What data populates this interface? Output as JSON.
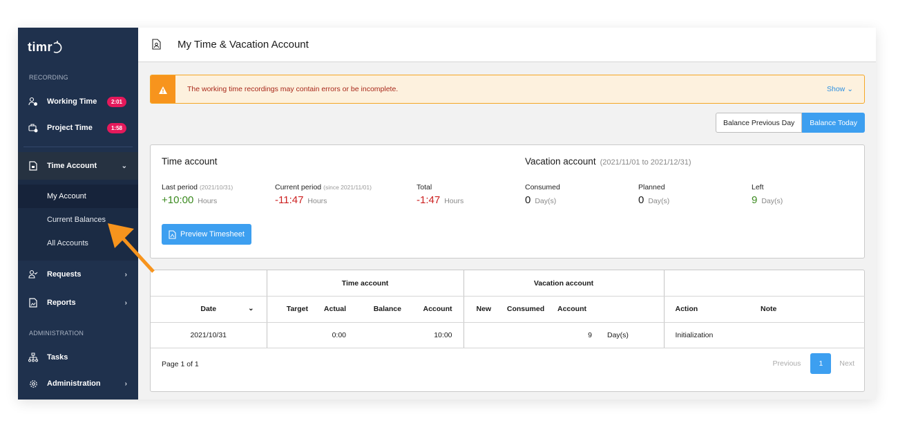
{
  "app": {
    "logo_text": "timr"
  },
  "sidebar": {
    "section_recording": "RECORDING",
    "section_administration": "ADMINISTRATION",
    "items": [
      {
        "label": "Working Time",
        "badge": "2:01",
        "icon": "user-clock-icon"
      },
      {
        "label": "Project Time",
        "badge": "1:58",
        "icon": "briefcase-clock-icon"
      },
      {
        "label": "Time Account",
        "icon": "document-icon",
        "expanded": true
      },
      {
        "label": "Requests",
        "icon": "user-check-icon"
      },
      {
        "label": "Reports",
        "icon": "report-icon"
      },
      {
        "label": "Tasks",
        "icon": "hierarchy-icon"
      },
      {
        "label": "Administration",
        "icon": "gear-icon"
      }
    ],
    "sub_items": [
      {
        "label": "My Account",
        "active": true
      },
      {
        "label": "Current Balances"
      },
      {
        "label": "All Accounts"
      }
    ]
  },
  "header": {
    "title": "My Time & Vacation Account"
  },
  "alert": {
    "message": "The working time recordings may contain errors or be incomplete.",
    "show_label": "Show"
  },
  "balance_toggle": {
    "previous_day": "Balance Previous Day",
    "today": "Balance Today",
    "selected": "today"
  },
  "time_account": {
    "title": "Time account",
    "last_period": {
      "label": "Last period",
      "hint": "(2021/10/31)",
      "value": "+10:00",
      "unit": "Hours"
    },
    "current_period": {
      "label": "Current period",
      "hint": "(since 2021/11/01)",
      "value": "-11:47",
      "unit": "Hours"
    },
    "total": {
      "label": "Total",
      "value": "-1:47",
      "unit": "Hours"
    },
    "preview_button": "Preview Timesheet"
  },
  "vacation_account": {
    "title": "Vacation account",
    "range": "(2021/11/01 to 2021/12/31)",
    "consumed": {
      "label": "Consumed",
      "value": "0",
      "unit": "Day(s)"
    },
    "planned": {
      "label": "Planned",
      "value": "0",
      "unit": "Day(s)"
    },
    "left": {
      "label": "Left",
      "value": "9",
      "unit": "Day(s)"
    }
  },
  "table": {
    "group_headers": {
      "time": "Time account",
      "vacation": "Vacation account"
    },
    "columns": {
      "date": "Date",
      "target": "Target",
      "actual": "Actual",
      "balance": "Balance",
      "account": "Account",
      "new": "New",
      "consumed": "Consumed",
      "vac_account": "Account",
      "action": "Action",
      "note": "Note"
    },
    "rows": [
      {
        "date": "2021/10/31",
        "target": "",
        "actual": "0:00",
        "balance": "",
        "account": "10:00",
        "new": "",
        "consumed": "",
        "vac_account": "9",
        "vac_unit": "Day(s)",
        "action": "Initialization",
        "note": ""
      }
    ],
    "pagination": {
      "label": "Page 1 of 1",
      "previous": "Previous",
      "current": "1",
      "next": "Next"
    }
  },
  "colors": {
    "sidebar": "#1f314d",
    "accent": "#3d9ff0",
    "badge": "#e5195b",
    "warning": "#f7941d",
    "positive": "#3b8a1f",
    "negative": "#cc1f1f",
    "annotation_arrow": "#f7941d"
  }
}
